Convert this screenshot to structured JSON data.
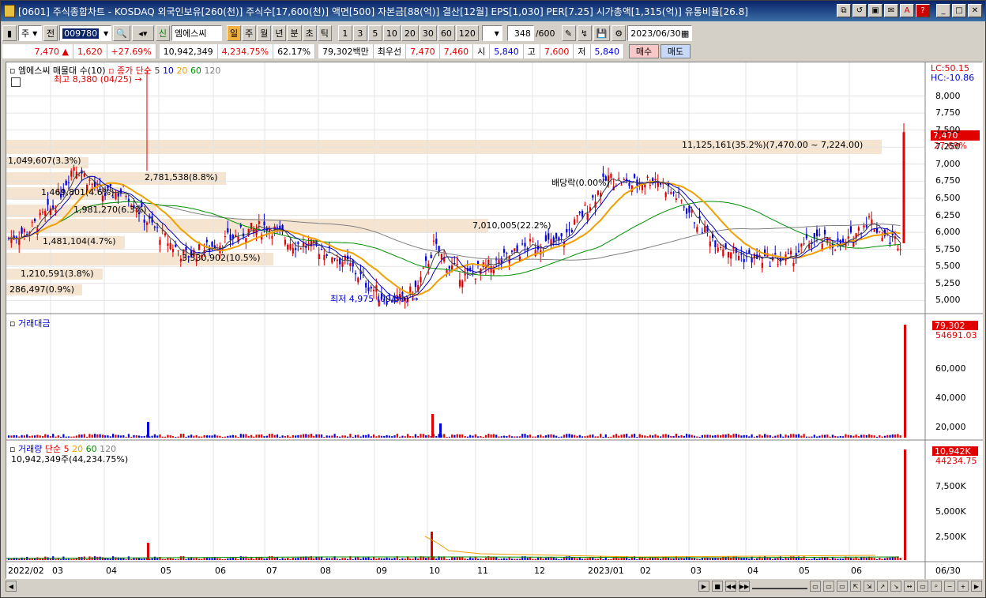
{
  "window": {
    "title": "[0601] 주식종합차트 - KOSDAQ 외국인보유[260(천)] 주식수[17,600(천)] 액면[500] 자본금[88(억)] 결산[12월] EPS[1,030] PER[7.25] 시가총액[1,315(억)] 유통비율[26.8]"
  },
  "toolbar": {
    "period_type": "주",
    "prev_label": "전",
    "code": "009780",
    "name": "엠에스씨",
    "credit_label": "신",
    "tabs": [
      "일",
      "주",
      "월",
      "년",
      "분",
      "초",
      "틱"
    ],
    "intervals": [
      "1",
      "3",
      "5",
      "10",
      "20",
      "30",
      "60",
      "120"
    ],
    "count": "348",
    "total": "/600",
    "date": "2023/06/30"
  },
  "quote": {
    "price": "7,470",
    "change_arrow": "▲",
    "change": "1,620",
    "change_pct": "+27.69%",
    "volume": "10,942,349",
    "volume_pct": "4,234.75%",
    "turnover": "62.17%",
    "amount": "79,302백만",
    "best_label": "최우선",
    "ask": "7,470",
    "bid": "7,460",
    "open_label": "시",
    "open": "5,840",
    "high_label": "고",
    "high": "7,600",
    "low_label": "저",
    "low": "5,840",
    "buy_label": "매수",
    "sell_label": "매도"
  },
  "price_panel": {
    "legend_name": "엠에스씨 매물대 수(10)",
    "legend_ma_label": "종가 단순",
    "ma_periods": [
      "5",
      "10",
      "20",
      "60",
      "120"
    ],
    "lc": "LC:50.15",
    "hc": "HC:-10.86",
    "high_note": "최고 8,380 (04/25)",
    "low_note": "최저 4,975 (09/30)",
    "dividend_note": "배당락(0.00%)",
    "current_price_label": "7,470",
    "current_pct_label": "27.69%",
    "volume_profile": [
      "11,125,161(35.2%)(7,470.00 ~ 7,224.00)",
      "1,049,607(3.3%)",
      "2,781,538(8.8%)",
      "1,469,801(4.6%)",
      "1,981,270(6.3%)",
      "7,010,005(22.2%)",
      "1,481,104(4.7%)",
      "3,330,902(10.5%)",
      "1,210,591(3.8%)",
      "286,497(0.9%)"
    ],
    "y_ticks": [
      "8,000",
      "7,750",
      "7,500",
      "7,250",
      "7,000",
      "6,750",
      "6,500",
      "6,250",
      "6,000",
      "5,750",
      "5,500",
      "5,250",
      "5,000"
    ]
  },
  "amount_panel": {
    "legend": "거래대금",
    "last_label": "79,302",
    "avg_label": "54691.03",
    "y_ticks": [
      "60,000",
      "40,000",
      "20,000"
    ]
  },
  "volume_panel": {
    "legend": "거래량",
    "ma_label": "단순",
    "ma_periods": [
      "5",
      "20",
      "60",
      "120"
    ],
    "value_note": "10,942,349주(44,234.75%)",
    "last_label": "10,942K",
    "pct_label": "44234.75",
    "y_ticks": [
      "7,500K",
      "5,000K",
      "2,500K"
    ]
  },
  "x_axis": [
    "2022/02",
    "03",
    "04",
    "05",
    "06",
    "07",
    "08",
    "09",
    "10",
    "11",
    "12",
    "2023/01",
    "02",
    "03",
    "04",
    "05",
    "06",
    "06/30"
  ],
  "colors": {
    "up": "#e00000",
    "down": "#0000e0",
    "ma5": "#404040",
    "ma10": "#0000c0",
    "ma20": "#f0a000",
    "ma60": "#009000",
    "ma120": "#808080",
    "profile": "#f5e4d0"
  },
  "chart_data": {
    "type": "candlestick",
    "ylim": [
      4900,
      8400
    ],
    "notable": [
      {
        "x": "2022/04/25",
        "high": 8380
      },
      {
        "x": "2022/09/30",
        "low": 4975
      },
      {
        "x": "2023/06/30",
        "open": 5840,
        "high": 7600,
        "low": 5840,
        "close": 7470
      }
    ]
  }
}
